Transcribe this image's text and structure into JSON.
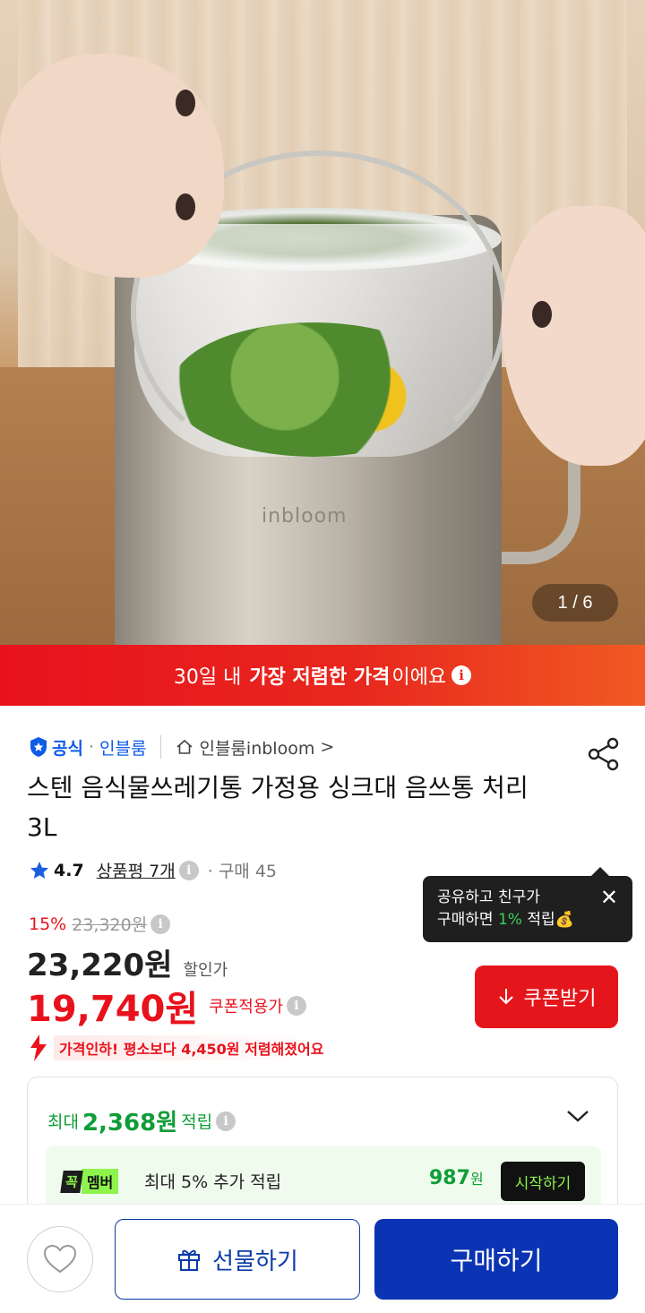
{
  "hero": {
    "brand_text": "inbloom",
    "counter": "1 / 6"
  },
  "banner": {
    "pre": "30일 내",
    "bold": "가장 저렴한 가격",
    "post": "이에요"
  },
  "seller": {
    "official": "공식",
    "separator": "·",
    "store": "인블룸",
    "home_link": "인블룸inbloom",
    "arrow": ">"
  },
  "product": {
    "title": "스텐 음식물쓰레기통 가정용 싱크대 음쓰통 처리 3L"
  },
  "rating": {
    "score": "4.7",
    "review_label": "상품평 7개",
    "purchase": "· 구매 45"
  },
  "tooltip": {
    "line1": "공유하고 친구가",
    "line2_pre": "구매하면",
    "line2_pct": "1%",
    "line2_post": "적립",
    "emoji": "💰",
    "close": "✕"
  },
  "price": {
    "discount_rate": "15%",
    "original": "23,320원",
    "sale": "23,220원",
    "sale_label": "할인가",
    "coupon_price": "19,740원",
    "coupon_label": "쿠폰적용가",
    "coupon_button": "쿠폰받기",
    "drop_notice": "가격인하! 평소보다 4,450원 저렴해졌어요"
  },
  "points": {
    "pre": "최대",
    "amount": "2,368원",
    "post": "적립",
    "member_g": "꼭",
    "member_m": "멤버",
    "member_desc": "최대 5% 추가 적립",
    "member_points": "987",
    "member_unit": "원",
    "member_start": "시작하기"
  },
  "bottom": {
    "gift": "선물하기",
    "buy": "구매하기"
  },
  "colors": {
    "red": "#e8121c",
    "blue": "#0b34b4",
    "green": "#0f9d37",
    "lime": "#8df34d"
  }
}
